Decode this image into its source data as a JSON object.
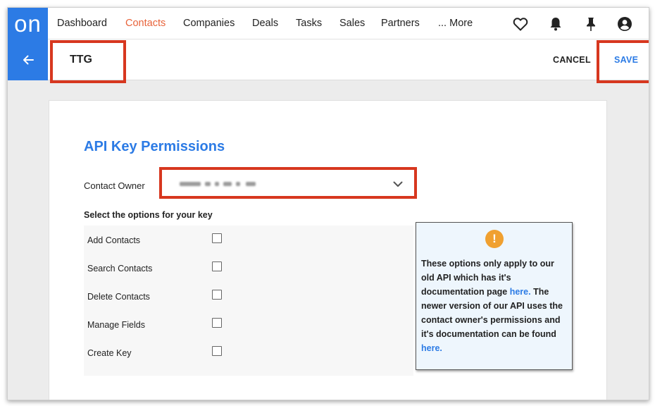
{
  "app": {
    "logo_text": "on",
    "brand_color": "#2c7be5",
    "active_nav_color": "#e8633a",
    "highlight_color": "#d7371f"
  },
  "nav": {
    "items": [
      {
        "label": "Dashboard"
      },
      {
        "label": "Contacts"
      },
      {
        "label": "Companies"
      },
      {
        "label": "Deals"
      },
      {
        "label": "Tasks"
      },
      {
        "label": "Sales"
      },
      {
        "label": "Partners"
      },
      {
        "label": "... More"
      }
    ],
    "active": "Contacts",
    "icons": [
      "heart-icon",
      "bell-icon",
      "pin-icon",
      "user-account-icon"
    ]
  },
  "header": {
    "back_icon": "arrow-left-icon",
    "record_title": "TTG",
    "cancel_label": "CANCEL",
    "save_label": "SAVE"
  },
  "form": {
    "title": "API Key Permissions",
    "owner_label": "Contact Owner",
    "owner_value_note": "blurred value",
    "options_heading": "Select the options for your key",
    "options": [
      {
        "label": "Add Contacts",
        "checked": false
      },
      {
        "label": "Search Contacts",
        "checked": false
      },
      {
        "label": "Delete Contacts",
        "checked": false
      },
      {
        "label": "Manage Fields",
        "checked": false
      },
      {
        "label": "Create Key",
        "checked": false
      }
    ]
  },
  "notice": {
    "icon": "exclamation-icon",
    "text_1": "These options only apply to our old API which has it's documentation page ",
    "link_1": "here.",
    "text_2": " The newer version of our API uses the contact owner's permissions and it's documentation can be found ",
    "link_2": "here."
  }
}
